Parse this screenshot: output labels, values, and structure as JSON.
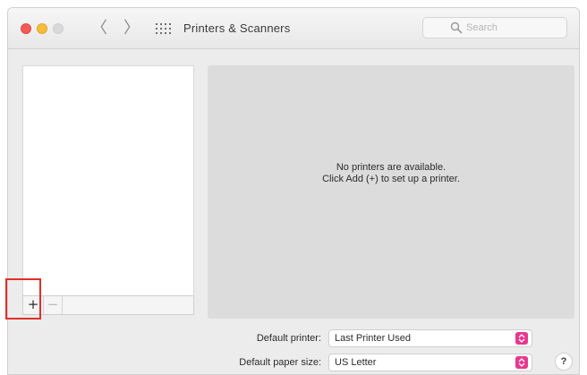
{
  "window": {
    "title": "Printers & Scanners"
  },
  "toolbar": {
    "back_glyph": "〈",
    "forward_glyph": "〉",
    "show_all_icon": "grid-icon",
    "search_placeholder": "Search"
  },
  "printer_list": {
    "items": [],
    "add_label": "+",
    "remove_label": "−"
  },
  "detail": {
    "empty_line1": "No printers are available.",
    "empty_line2": "Click Add (+) to set up a printer."
  },
  "defaults": {
    "default_printer_label": "Default printer:",
    "default_printer_value": "Last Printer Used",
    "paper_size_label": "Default paper size:",
    "paper_size_value": "US Letter"
  },
  "help_label": "?",
  "colors": {
    "highlight": "#e0302a",
    "popup_accent": "#e6398d",
    "close": "#f05b55",
    "minimize": "#f6bd3b"
  }
}
